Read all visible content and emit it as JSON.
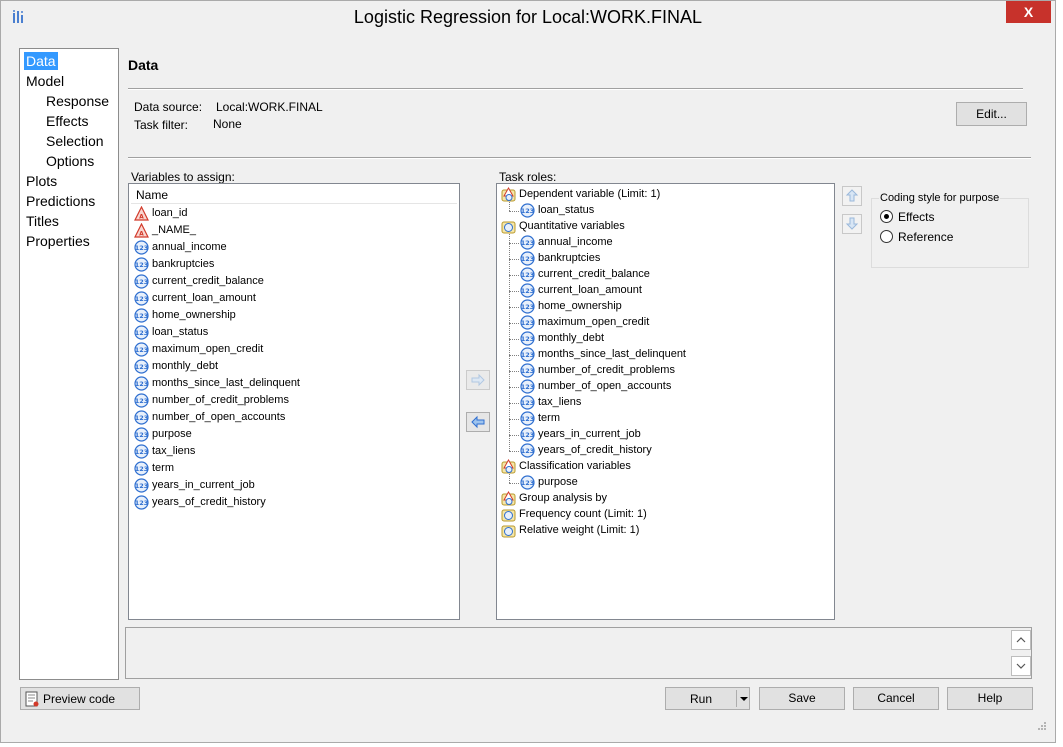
{
  "window": {
    "title": "Logistic Regression  for Local:WORK.FINAL",
    "close": "X"
  },
  "nav": {
    "items": [
      {
        "label": "Data",
        "level": 0,
        "selected": true
      },
      {
        "label": "Model",
        "level": 0
      },
      {
        "label": "Response",
        "level": 1
      },
      {
        "label": "Effects",
        "level": 1
      },
      {
        "label": "Selection",
        "level": 1
      },
      {
        "label": "Options",
        "level": 1
      },
      {
        "label": "Plots",
        "level": 0
      },
      {
        "label": "Predictions",
        "level": 0
      },
      {
        "label": "Titles",
        "level": 0
      },
      {
        "label": "Properties",
        "level": 0
      }
    ]
  },
  "panel": {
    "title": "Data",
    "data_source_label": "Data source:",
    "data_source_value": "Local:WORK.FINAL",
    "task_filter_label": "Task filter:",
    "task_filter_value": "None",
    "edit_button": "Edit..."
  },
  "variables": {
    "label": "Variables to assign:",
    "header": "Name",
    "items": [
      {
        "name": "loan_id",
        "icon": "character-variable-icon"
      },
      {
        "name": "_NAME_",
        "icon": "character-variable-icon"
      },
      {
        "name": "annual_income",
        "icon": "numeric-variable-icon"
      },
      {
        "name": "bankruptcies",
        "icon": "numeric-variable-icon"
      },
      {
        "name": "current_credit_balance",
        "icon": "numeric-variable-icon"
      },
      {
        "name": "current_loan_amount",
        "icon": "numeric-variable-icon"
      },
      {
        "name": "home_ownership",
        "icon": "numeric-variable-icon"
      },
      {
        "name": "loan_status",
        "icon": "numeric-variable-icon"
      },
      {
        "name": "maximum_open_credit",
        "icon": "numeric-variable-icon"
      },
      {
        "name": "monthly_debt",
        "icon": "numeric-variable-icon"
      },
      {
        "name": "months_since_last_delinquent",
        "icon": "numeric-variable-icon"
      },
      {
        "name": "number_of_credit_problems",
        "icon": "numeric-variable-icon"
      },
      {
        "name": "number_of_open_accounts",
        "icon": "numeric-variable-icon"
      },
      {
        "name": "purpose",
        "icon": "numeric-variable-icon"
      },
      {
        "name": "tax_liens",
        "icon": "numeric-variable-icon"
      },
      {
        "name": "term",
        "icon": "numeric-variable-icon"
      },
      {
        "name": "years_in_current_job",
        "icon": "numeric-variable-icon"
      },
      {
        "name": "years_of_credit_history",
        "icon": "numeric-variable-icon"
      }
    ]
  },
  "roles": {
    "label": "Task roles:",
    "items": [
      {
        "text": "Dependent variable  (Limit: 1)",
        "type": "role-alpha",
        "level": 0
      },
      {
        "text": "loan_status",
        "type": "var",
        "level": 1
      },
      {
        "text": "Quantitative variables",
        "type": "role-num",
        "level": 0
      },
      {
        "text": "annual_income",
        "type": "var",
        "level": 1
      },
      {
        "text": "bankruptcies",
        "type": "var",
        "level": 1
      },
      {
        "text": "current_credit_balance",
        "type": "var",
        "level": 1
      },
      {
        "text": "current_loan_amount",
        "type": "var",
        "level": 1
      },
      {
        "text": "home_ownership",
        "type": "var",
        "level": 1
      },
      {
        "text": "maximum_open_credit",
        "type": "var",
        "level": 1
      },
      {
        "text": "monthly_debt",
        "type": "var",
        "level": 1
      },
      {
        "text": "months_since_last_delinquent",
        "type": "var",
        "level": 1
      },
      {
        "text": "number_of_credit_problems",
        "type": "var",
        "level": 1
      },
      {
        "text": "number_of_open_accounts",
        "type": "var",
        "level": 1
      },
      {
        "text": "tax_liens",
        "type": "var",
        "level": 1
      },
      {
        "text": "term",
        "type": "var",
        "level": 1
      },
      {
        "text": "years_in_current_job",
        "type": "var",
        "level": 1
      },
      {
        "text": "years_of_credit_history",
        "type": "var",
        "level": 1
      },
      {
        "text": "Classification variables",
        "type": "role-alpha",
        "level": 0
      },
      {
        "text": "purpose",
        "type": "var",
        "level": 1
      },
      {
        "text": "Group analysis by",
        "type": "role-alpha",
        "level": 0
      },
      {
        "text": "Frequency count  (Limit: 1)",
        "type": "role-num",
        "level": 0
      },
      {
        "text": "Relative weight  (Limit: 1)",
        "type": "role-num",
        "level": 0
      }
    ]
  },
  "coding": {
    "label": "Coding style for purpose",
    "options": [
      {
        "label": "Effects",
        "selected": true
      },
      {
        "label": "Reference",
        "selected": false
      }
    ]
  },
  "footer": {
    "preview_code": "Preview code",
    "run": "Run",
    "save": "Save",
    "cancel": "Cancel",
    "help": "Help"
  },
  "colors": {
    "selection": "#3399ff",
    "close": "#c7322b",
    "numeric_icon": "#2f6fd0",
    "character_icon": "#d23a2a"
  }
}
